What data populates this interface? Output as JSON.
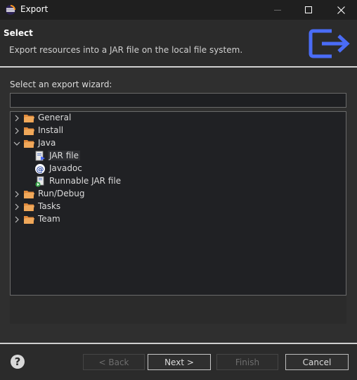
{
  "window": {
    "title": "Export"
  },
  "header": {
    "title": "Select",
    "description": "Export resources into a JAR file on the local file system.",
    "icon": "export-icon"
  },
  "filter": {
    "label": "Select an export wizard:",
    "value": "",
    "placeholder": ""
  },
  "tree": {
    "items": [
      {
        "label": "General",
        "expanded": false,
        "icon": "folder-icon"
      },
      {
        "label": "Install",
        "expanded": false,
        "icon": "folder-icon"
      },
      {
        "label": "Java",
        "expanded": true,
        "icon": "folder-icon"
      },
      {
        "label": "JAR file",
        "icon": "jar-file-icon",
        "selected": true
      },
      {
        "label": "Javadoc",
        "icon": "javadoc-icon"
      },
      {
        "label": "Runnable JAR file",
        "icon": "runnable-jar-icon"
      },
      {
        "label": "Run/Debug",
        "expanded": false,
        "icon": "folder-icon"
      },
      {
        "label": "Tasks",
        "expanded": false,
        "icon": "folder-icon"
      },
      {
        "label": "Team",
        "expanded": false,
        "icon": "folder-icon"
      }
    ]
  },
  "buttons": {
    "help": "?",
    "back": "< Back",
    "next": "Next >",
    "finish": "Finish",
    "cancel": "Cancel"
  },
  "colors": {
    "accent": "#4a6cf7",
    "folder": "#e08a3c",
    "background": "#2f2f2f"
  }
}
